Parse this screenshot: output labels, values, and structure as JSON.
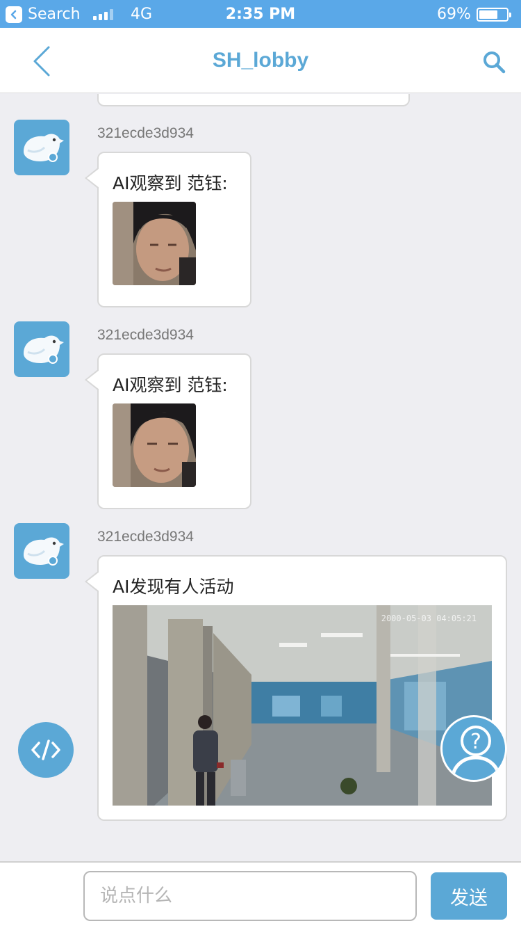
{
  "status_bar": {
    "back_app_label": "Search",
    "carrier": "4G",
    "time": "2:35 PM",
    "battery_percent": "69%",
    "battery_level": 0.69,
    "signal_bars_filled": 3
  },
  "nav": {
    "title": "SH_lobby",
    "back_icon": "chevron-left-icon",
    "search_icon": "search-icon"
  },
  "messages": [
    {
      "sender": "321ecde3d934",
      "text": "AI观察到 范钰:",
      "attachment": "face-thumbnail"
    },
    {
      "sender": "321ecde3d934",
      "text": "AI观察到 范钰:",
      "attachment": "face-thumbnail"
    },
    {
      "sender": "321ecde3d934",
      "text": "AI发现有人活动",
      "attachment": "cctv-snapshot",
      "snapshot_timestamp": "2000-05-03 04:05:21"
    }
  ],
  "floating": {
    "code_icon": "code-icon",
    "help_icon": "help-person-icon"
  },
  "input_bar": {
    "placeholder": "说点什么",
    "value": "",
    "send_label": "发送"
  },
  "colors": {
    "status_bar": "#5aa8e8",
    "accent": "#5ba8d6",
    "chat_background": "#eeeef2"
  }
}
